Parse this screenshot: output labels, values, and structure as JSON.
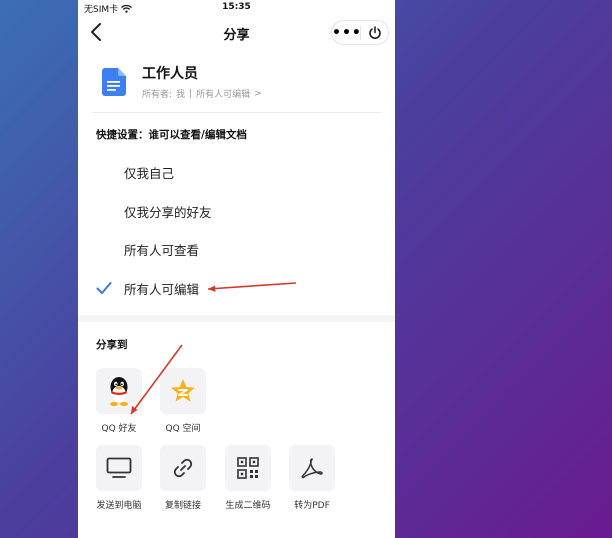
{
  "status_bar": {
    "carrier": "无SIM卡",
    "time": "15:35"
  },
  "navbar": {
    "title": "分享",
    "more_label": "•••"
  },
  "document": {
    "title": "工作人员",
    "owner_label": "所有者:",
    "owner_name": "我",
    "meta_sep": "|",
    "permission": "所有人可编辑",
    "meta_chevron": ">"
  },
  "quick_settings": {
    "label": "快捷设置：谁可以查看/编辑文档",
    "options": [
      {
        "label": "仅我自己",
        "selected": false
      },
      {
        "label": "仅我分享的好友",
        "selected": false
      },
      {
        "label": "所有人可查看",
        "selected": false
      },
      {
        "label": "所有人可编辑",
        "selected": true
      }
    ]
  },
  "share": {
    "label": "分享到",
    "items": [
      {
        "label": "QQ 好友",
        "icon": "qq-penguin-icon"
      },
      {
        "label": "QQ 空间",
        "icon": "qzone-star-icon"
      },
      {
        "label": "发送到电脑",
        "icon": "monitor-icon"
      },
      {
        "label": "复制链接",
        "icon": "link-icon"
      },
      {
        "label": "生成二维码",
        "icon": "qrcode-icon"
      },
      {
        "label": "转为PDF",
        "icon": "pdf-icon"
      }
    ]
  },
  "colors": {
    "accent_check": "#3a7bd5",
    "doc_icon": "#3d7ef1",
    "annotation_arrow": "#d23a2a",
    "qzone_star": "#f3b51f"
  }
}
